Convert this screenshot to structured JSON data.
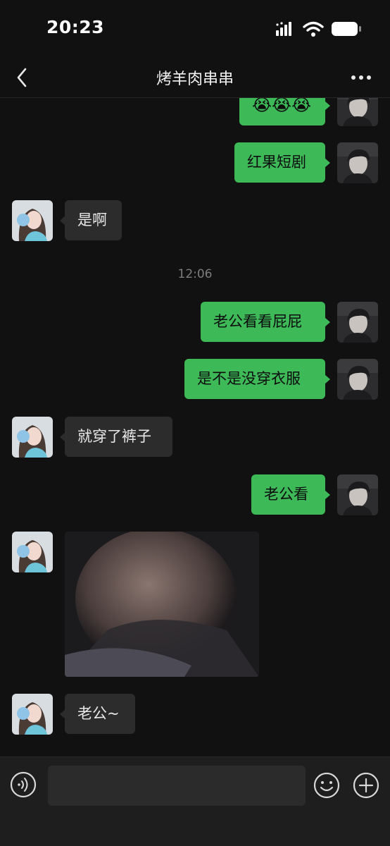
{
  "status_bar": {
    "time": "20:23"
  },
  "header": {
    "title": "烤羊肉串串"
  },
  "messages": {
    "m1_emoji": "😭😭😭",
    "m2": "红果短剧",
    "m3": "是啊",
    "time_sep": "12:06",
    "m4": "老公看看屁屁",
    "m5": "是不是没穿衣服",
    "m6": "就穿了裤子",
    "m7": "老公看",
    "m9": "老公~"
  },
  "input": {
    "value": ""
  },
  "colors": {
    "background": "#111111",
    "sent_bubble": "#3db958",
    "received_bubble": "#2c2c2c",
    "input_bar": "#1e1e1e"
  },
  "icons": {
    "back": "chevron-left-icon",
    "more": "ellipsis-icon",
    "voice": "voice-icon",
    "emoji": "smiley-icon",
    "plus": "plus-circle-icon"
  }
}
